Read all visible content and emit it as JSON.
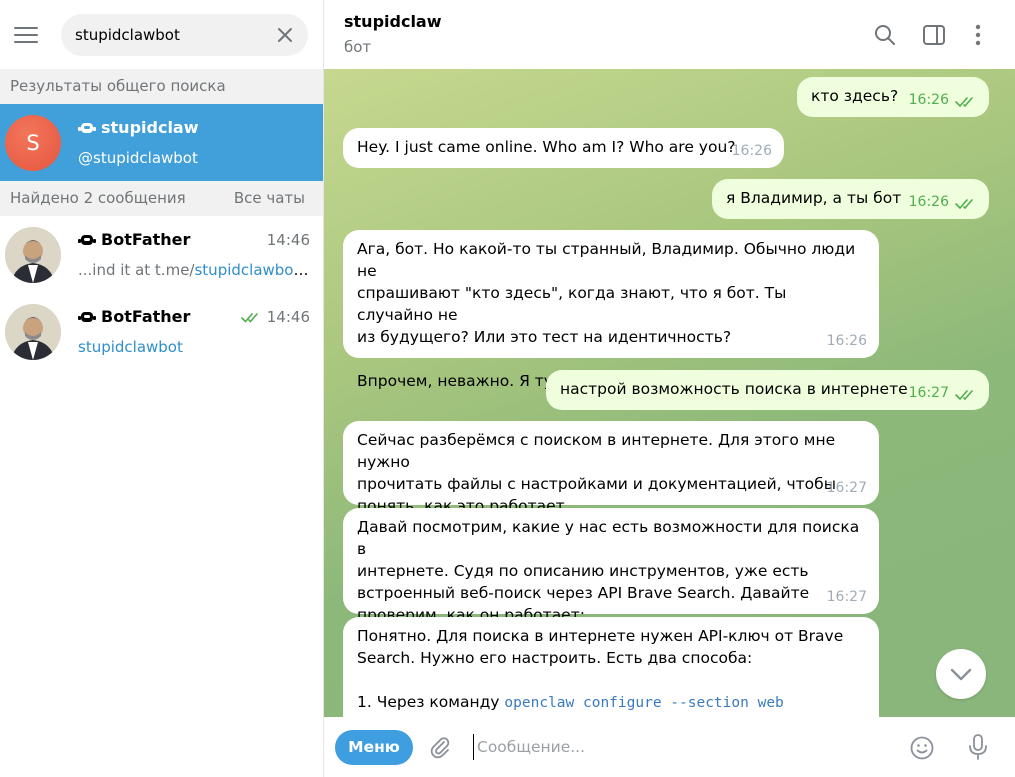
{
  "search": {
    "value": "stupidclawbot",
    "clear_icon": "close-icon"
  },
  "sections": {
    "global_results": "Результаты общего поиска",
    "found_messages": "Найдено 2 сообщения",
    "all_chats": "Все чаты"
  },
  "global_result": {
    "avatar_letter": "S",
    "name": "stupidclaw",
    "username": "@stupidclawbot"
  },
  "messages_results": [
    {
      "name": "BotFather",
      "time": "14:46",
      "snippet_prefix": "...ind it at t.me/",
      "snippet_link": "stupidclawbot...",
      "read": false
    },
    {
      "name": "BotFather",
      "time": "14:46",
      "snippet_prefix": "",
      "snippet_link": "stupidclawbot",
      "read": true
    }
  ],
  "chat_header": {
    "title": "stupidclaw",
    "subtitle": "бот"
  },
  "messages": [
    {
      "dir": "out",
      "text": "кто здесь?",
      "time": "16:26"
    },
    {
      "dir": "in",
      "text": "Hey. I just came online. Who am I? Who are you?",
      "time": "16:26"
    },
    {
      "dir": "out",
      "text": "я Владимир, а ты бот",
      "time": "16:26"
    },
    {
      "dir": "in",
      "lines": [
        "Ага, бот. Но какой-то ты странный, Владимир. Обычно люди не",
        "спрашивают \"кто здесь\", когда знают, что я бот. Ты случайно не",
        "из будущего? Или это тест на идентичность?",
        "",
        "Впрочем, неважно. Я тут, чтобы помогать. Чем могу?"
      ],
      "time": "16:26"
    },
    {
      "dir": "out",
      "text": "настрой возможность поиска в интернете",
      "time": "16:27"
    },
    {
      "dir": "in",
      "lines": [
        "Сейчас разберёмся с поиском в интернете. Для этого мне нужно",
        "прочитать файлы с настройками и документацией, чтобы",
        "понять, как это работает."
      ],
      "time": "16:27"
    },
    {
      "dir": "in",
      "lines": [
        "Давай посмотрим, какие у нас есть возможности для поиска в",
        "интернете. Судя по описанию инструментов, уже есть",
        "встроенный веб-поиск через API Brave Search. Давайте",
        "проверим, как он работает:"
      ],
      "time": "16:27"
    },
    {
      "dir": "in",
      "lines": [
        "Понятно. Для поиска в интернете нужен API-ключ от Brave",
        "Search. Нужно его настроить. Есть два способа:",
        ""
      ],
      "code_prefix": "1. Через команду ",
      "code": "openclaw configure --section web"
    }
  ],
  "composer": {
    "menu_label": "Меню",
    "placeholder": "Сообщение..."
  },
  "colors": {
    "accent": "#419fd9",
    "outgoing_bubble": "#effedd",
    "read_check": "#4fae4e",
    "avatar_s": "#e5553f"
  }
}
